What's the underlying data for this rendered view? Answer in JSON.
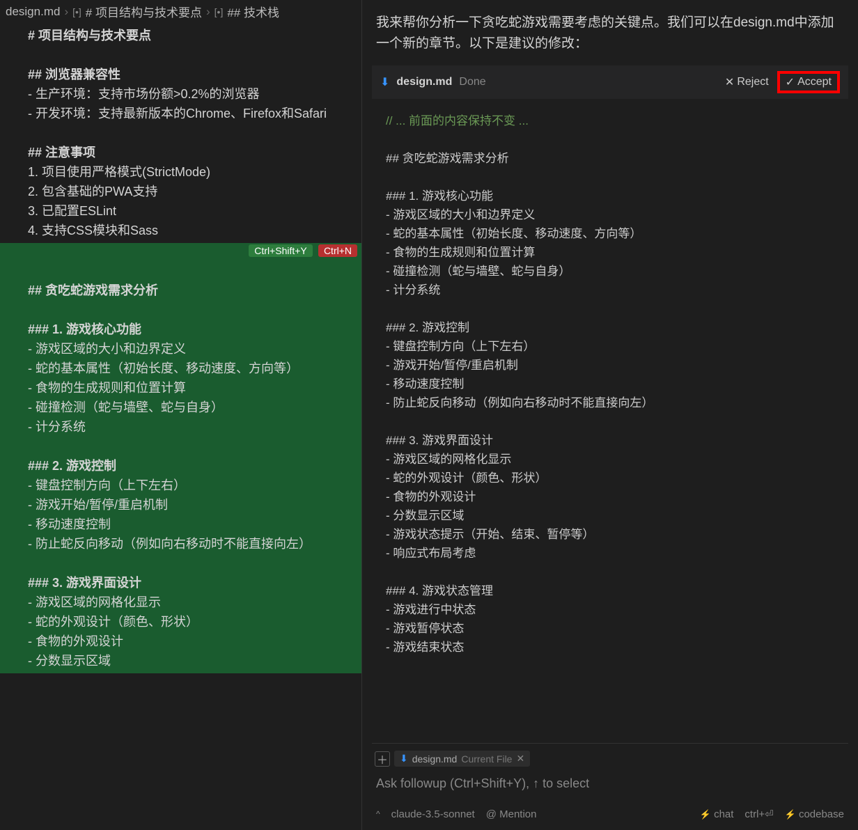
{
  "breadcrumb": {
    "file": "design.md",
    "section1_icon": "md-heading-icon",
    "section1": "# 项目结构与技术要点",
    "section2_icon": "md-heading-icon",
    "section2": "## 技术栈"
  },
  "editor_lines": [
    {
      "text": "# 项目结构与技术要点",
      "cls": "heading"
    },
    {
      "text": "",
      "cls": ""
    },
    {
      "text": "## 浏览器兼容性",
      "cls": "heading"
    },
    {
      "text": "- 生产环境：支持市场份额>0.2%的浏览器",
      "cls": ""
    },
    {
      "text": "- 开发环境：支持最新版本的Chrome、Firefox和Safari",
      "cls": ""
    },
    {
      "text": "",
      "cls": ""
    },
    {
      "text": "## 注意事项",
      "cls": "heading"
    },
    {
      "text": "1. 项目使用严格模式(StrictMode)",
      "cls": ""
    },
    {
      "text": "2. 包含基础的PWA支持",
      "cls": ""
    },
    {
      "text": "3. 已配置ESLint",
      "cls": ""
    },
    {
      "text": "4. 支持CSS模块和Sass",
      "cls": ""
    }
  ],
  "shortcut_badges": {
    "green": "Ctrl+Shift+Y",
    "red": "Ctrl+N"
  },
  "diff_lines": [
    {
      "text": "",
      "cls": ""
    },
    {
      "text": "## 贪吃蛇游戏需求分析",
      "cls": "heading"
    },
    {
      "text": "",
      "cls": ""
    },
    {
      "text": "### 1. 游戏核心功能",
      "cls": "heading"
    },
    {
      "text": "- 游戏区域的大小和边界定义",
      "cls": ""
    },
    {
      "text": "- 蛇的基本属性（初始长度、移动速度、方向等）",
      "cls": ""
    },
    {
      "text": "- 食物的生成规则和位置计算",
      "cls": ""
    },
    {
      "text": "- 碰撞检测（蛇与墙壁、蛇与自身）",
      "cls": ""
    },
    {
      "text": "- 计分系统",
      "cls": ""
    },
    {
      "text": "",
      "cls": ""
    },
    {
      "text": "### 2. 游戏控制",
      "cls": "heading"
    },
    {
      "text": "- 键盘控制方向（上下左右）",
      "cls": ""
    },
    {
      "text": "- 游戏开始/暂停/重启机制",
      "cls": ""
    },
    {
      "text": "- 移动速度控制",
      "cls": ""
    },
    {
      "text": "- 防止蛇反向移动（例如向右移动时不能直接向左）",
      "cls": ""
    },
    {
      "text": "",
      "cls": ""
    },
    {
      "text": "### 3. 游戏界面设计",
      "cls": "heading"
    },
    {
      "text": "- 游戏区域的网格化显示",
      "cls": ""
    },
    {
      "text": "- 蛇的外观设计（颜色、形状）",
      "cls": ""
    },
    {
      "text": "- 食物的外观设计",
      "cls": ""
    },
    {
      "text": "- 分数显示区域",
      "cls": ""
    }
  ],
  "assistant": {
    "intro": "我来帮你分析一下贪吃蛇游戏需要考虑的关键点。我们可以在design.md中添加一个新的章节。以下是建议的修改："
  },
  "file_header": {
    "filename": "design.md",
    "status": "Done",
    "reject": "Reject",
    "accept": "Accept"
  },
  "code_lines": [
    {
      "text": "// ... 前面的内容保持不变 ...",
      "cls": "comment"
    },
    {
      "text": "",
      "cls": ""
    },
    {
      "text": "## 贪吃蛇游戏需求分析",
      "cls": ""
    },
    {
      "text": "",
      "cls": ""
    },
    {
      "text": "### 1. 游戏核心功能",
      "cls": ""
    },
    {
      "text": "- 游戏区域的大小和边界定义",
      "cls": ""
    },
    {
      "text": "- 蛇的基本属性（初始长度、移动速度、方向等）",
      "cls": ""
    },
    {
      "text": "- 食物的生成规则和位置计算",
      "cls": ""
    },
    {
      "text": "- 碰撞检测（蛇与墙壁、蛇与自身）",
      "cls": ""
    },
    {
      "text": "- 计分系统",
      "cls": ""
    },
    {
      "text": "",
      "cls": ""
    },
    {
      "text": "### 2. 游戏控制",
      "cls": ""
    },
    {
      "text": "- 键盘控制方向（上下左右）",
      "cls": ""
    },
    {
      "text": "- 游戏开始/暂停/重启机制",
      "cls": ""
    },
    {
      "text": "- 移动速度控制",
      "cls": ""
    },
    {
      "text": "- 防止蛇反向移动（例如向右移动时不能直接向左）",
      "cls": ""
    },
    {
      "text": "",
      "cls": ""
    },
    {
      "text": "### 3. 游戏界面设计",
      "cls": ""
    },
    {
      "text": "- 游戏区域的网格化显示",
      "cls": ""
    },
    {
      "text": "- 蛇的外观设计（颜色、形状）",
      "cls": ""
    },
    {
      "text": "- 食物的外观设计",
      "cls": ""
    },
    {
      "text": "- 分数显示区域",
      "cls": ""
    },
    {
      "text": "- 游戏状态提示（开始、结束、暂停等）",
      "cls": ""
    },
    {
      "text": "- 响应式布局考虑",
      "cls": ""
    },
    {
      "text": "",
      "cls": ""
    },
    {
      "text": "### 4. 游戏状态管理",
      "cls": ""
    },
    {
      "text": "- 游戏进行中状态",
      "cls": ""
    },
    {
      "text": "- 游戏暂停状态",
      "cls": ""
    },
    {
      "text": "- 游戏结束状态",
      "cls": ""
    }
  ],
  "context_chip": {
    "filename": "design.md",
    "label": "Current File"
  },
  "input_placeholder": "Ask followup (Ctrl+Shift+Y), ↑ to select",
  "bottom_toolbar": {
    "model": "claude-3.5-sonnet",
    "mention": "@ Mention",
    "chat": "chat",
    "codebase_shortcut": "ctrl+⏎",
    "codebase": "codebase"
  }
}
